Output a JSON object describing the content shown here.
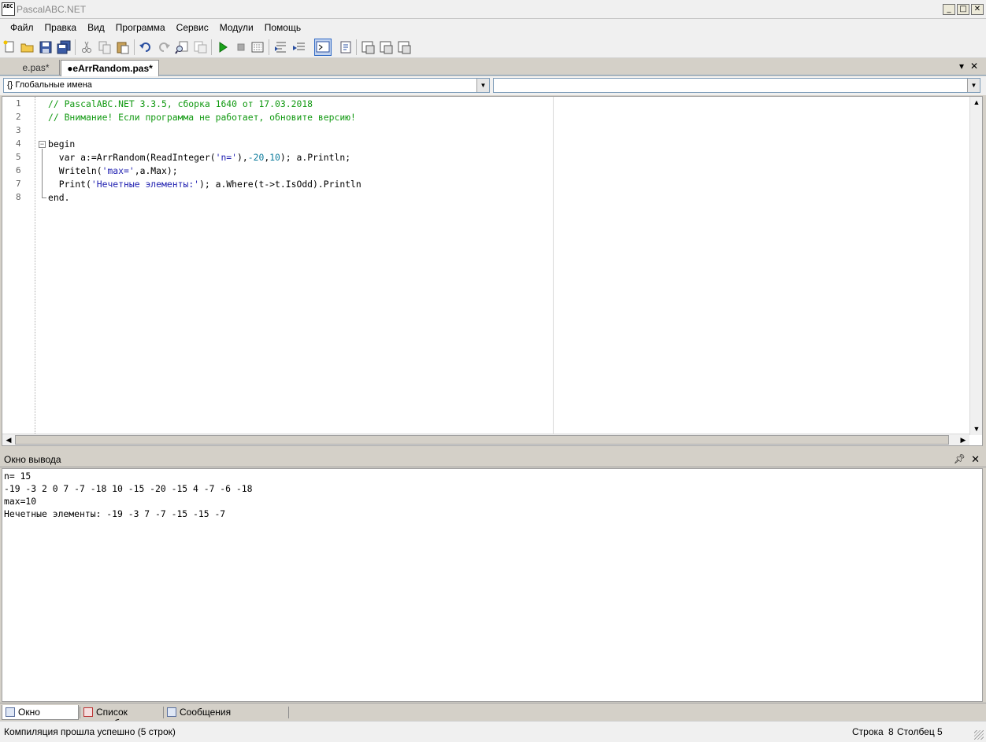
{
  "window": {
    "title": "PascalABC.NET",
    "icon_text": "ABC",
    "buttons": [
      "_",
      "□",
      "✕"
    ]
  },
  "menu": [
    "Файл",
    "Правка",
    "Вид",
    "Программа",
    "Сервис",
    "Модули",
    "Помощь"
  ],
  "tabs": [
    {
      "label": "e.pas*"
    },
    {
      "label": "●eArrRandom.pas*"
    }
  ],
  "tab_controls": {
    "dropdown": "▾",
    "close": "✕"
  },
  "combos": {
    "left": "{} Глобальные имена",
    "right": ""
  },
  "editor": {
    "line_numbers": [
      "1",
      "2",
      "3",
      "4",
      "5",
      "6",
      "7",
      "8"
    ],
    "lines": [
      [
        {
          "t": "// PascalABC.NET 3.3.5, сборка 1640 от 17.03.2018",
          "c": "cmt"
        }
      ],
      [
        {
          "t": "// Внимание! Если программа не работает, обновите версию!",
          "c": "cmt"
        }
      ],
      [],
      [
        {
          "t": "begin",
          "c": ""
        }
      ],
      [
        {
          "t": "  var a:=ArrRandom(ReadInteger(",
          "c": ""
        },
        {
          "t": "'n='",
          "c": "str"
        },
        {
          "t": "),",
          "c": ""
        },
        {
          "t": "-20",
          "c": "num"
        },
        {
          "t": ",",
          "c": ""
        },
        {
          "t": "10",
          "c": "num"
        },
        {
          "t": "); a.Println;",
          "c": ""
        }
      ],
      [
        {
          "t": "  Writeln(",
          "c": ""
        },
        {
          "t": "'max='",
          "c": "str"
        },
        {
          "t": ",a.Max);",
          "c": ""
        }
      ],
      [
        {
          "t": "  Print(",
          "c": ""
        },
        {
          "t": "'Нечетные элементы:'",
          "c": "str"
        },
        {
          "t": "); a.Where(t->t.IsOdd).Println",
          "c": ""
        }
      ],
      [
        {
          "t": "end.",
          "c": ""
        }
      ]
    ]
  },
  "output": {
    "title": "Окно вывода",
    "lines": [
      "n= 15",
      "-19 -3 2 0 7 -7 -18 10 -15 -20 -15 4 -7 -6 -18",
      "max=10",
      "Нечетные элементы: -19 -3 7 -7 -15 -15 -7"
    ]
  },
  "bottom_tabs": [
    {
      "label": "Окно вывода"
    },
    {
      "label": "Список ошибок"
    },
    {
      "label": "Сообщения компилятора"
    }
  ],
  "status": {
    "message": "Компиляция прошла успешно (5 строк)",
    "row_label": "Строка",
    "row": "8",
    "col_label": "Столбец",
    "col": "5"
  }
}
